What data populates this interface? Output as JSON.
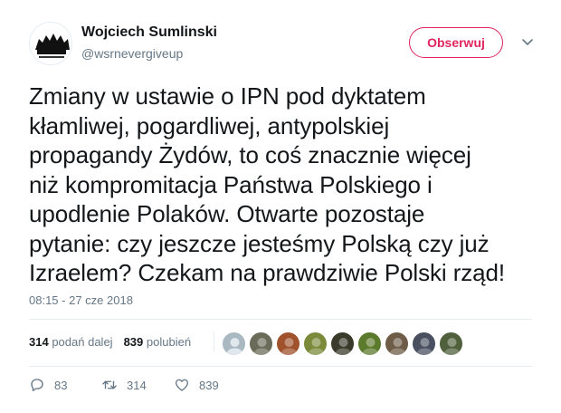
{
  "author": {
    "name": "Wojciech Sumlinski",
    "handle": "@wsrnevergiveup",
    "avatar_icon": "logo-avatar-icon"
  },
  "follow_button": {
    "label": "Obserwuj",
    "color": "#e0245e"
  },
  "tweet": {
    "text": "Zmiany w ustawie o IPN pod dyktatem\nkłamliwej, pogardliwej, antypolskiej\npropagandy Żydów, to coś znacznie więcej\nniż kompromitacja Państwa Polskiego i\nupodlenie Polaków. Otwarte pozostaje\npytanie: czy jeszcze jesteśmy Polską czy już\nIzraelem? Czekam na prawdziwie Polski rząd!",
    "timestamp": "08:15 - 27 cze 2018"
  },
  "stats": {
    "retweets_count": "314",
    "retweets_label": "podań dalej",
    "likes_count": "839",
    "likes_label": "polubień"
  },
  "likers": [
    {
      "color": "#aab8c2"
    },
    {
      "color": "#6b6b5a"
    },
    {
      "color": "#a0522d"
    },
    {
      "color": "#7a8a3a"
    },
    {
      "color": "#3a3a2a"
    },
    {
      "color": "#5c7a2c"
    },
    {
      "color": "#6e5c48"
    },
    {
      "color": "#4a5060"
    },
    {
      "color": "#50603c"
    }
  ],
  "actions": {
    "reply_count": "83",
    "retweet_count": "314",
    "like_count": "839"
  },
  "colors": {
    "text": "#14171a",
    "secondary": "#657786",
    "accent": "#e0245e",
    "border": "#e6ecf0"
  }
}
